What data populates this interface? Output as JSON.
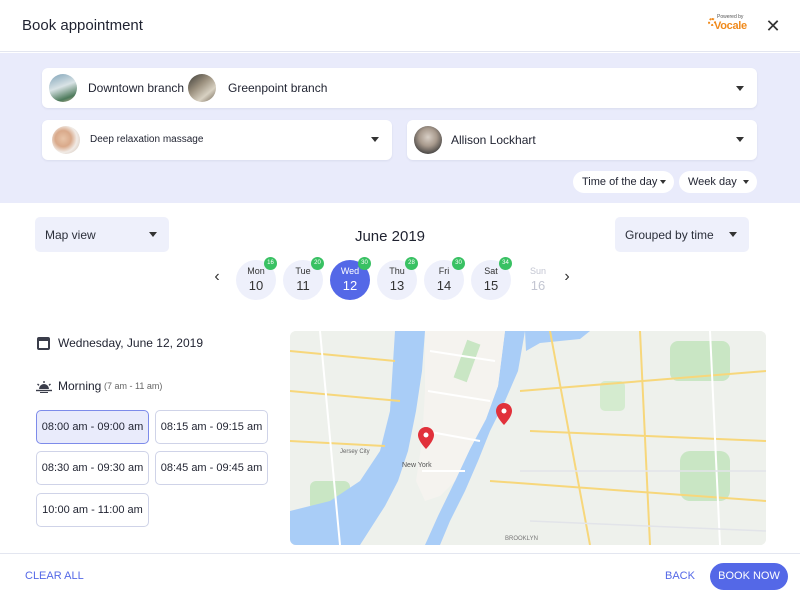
{
  "header": {
    "title": "Book appointment",
    "powered_by": "Powered by",
    "brand": "Vocale",
    "close_icon": "close-icon"
  },
  "filters": {
    "branches": [
      "Downtown branch",
      "Greenpoint branch"
    ],
    "service": "Deep relaxation massage",
    "staff": "Allison Lockhart",
    "time_of_day": "Time of the day",
    "week_day": "Week day"
  },
  "toolbar": {
    "view": "Map view",
    "month": "June 2019",
    "grouping": "Grouped by time"
  },
  "days": [
    {
      "name": "Mon",
      "date": "10",
      "count": "16"
    },
    {
      "name": "Tue",
      "date": "11",
      "count": "20"
    },
    {
      "name": "Wed",
      "date": "12",
      "count": "30",
      "selected": true
    },
    {
      "name": "Thu",
      "date": "13",
      "count": "28"
    },
    {
      "name": "Fri",
      "date": "14",
      "count": "30"
    },
    {
      "name": "Sat",
      "date": "15",
      "count": "34"
    },
    {
      "name": "Sun",
      "date": "16",
      "count": "",
      "disabled": true
    }
  ],
  "schedule": {
    "date": "Wednesday, June 12, 2019",
    "period": "Morning",
    "period_range": "(7 am - 11 am)",
    "slots": [
      "08:00 am - 09:00 am",
      "08:15 am - 09:15 am",
      "08:30 am - 09:30 am",
      "08:45 am - 09:45 am",
      "10:00 am - 11:00 am"
    ],
    "selected_slot": "08:00 am - 09:00 am"
  },
  "map": {
    "labels": [
      "New York",
      "Jersey City",
      "BROOKLYN"
    ]
  },
  "footer": {
    "clear": "CLEAR ALL",
    "back": "BACK",
    "book": "BOOK NOW"
  },
  "colors": {
    "accent": "#5468e7",
    "panel_bg": "#e9ebfb",
    "badge": "#39c163",
    "marker": "#e1313b"
  }
}
